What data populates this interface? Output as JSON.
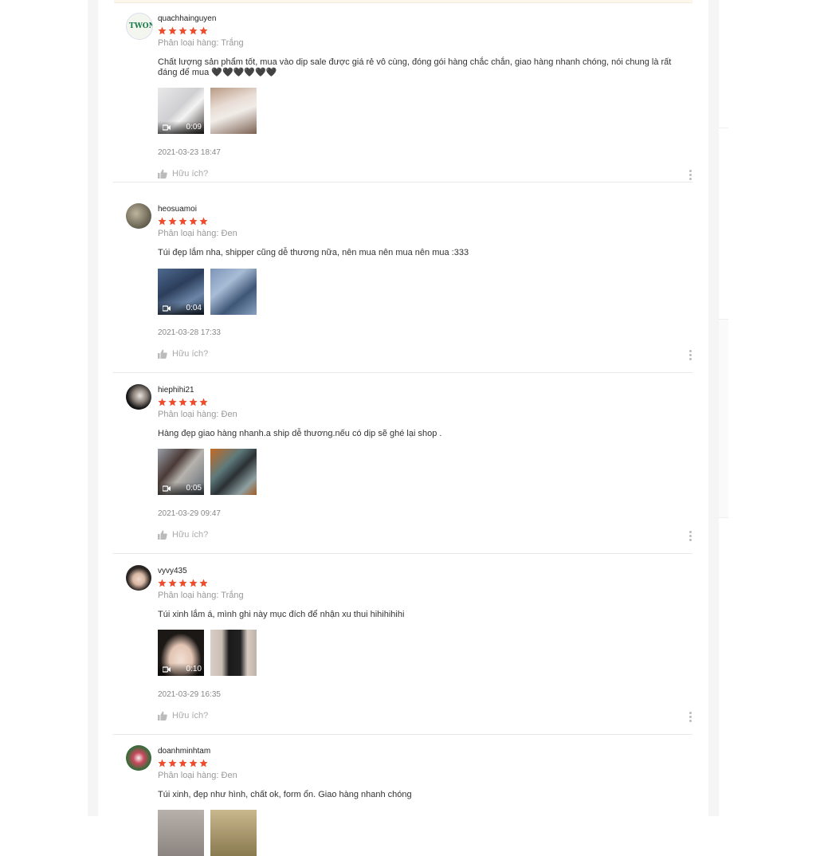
{
  "colors": {
    "star": "#ee4d2d",
    "text": "#333333",
    "muted": "#999999"
  },
  "helpful_label": "Hữu ích?",
  "reviews": [
    {
      "username": "quachhainguyen",
      "avatar_text": "TWON",
      "rating": 5,
      "variant": "Phân loại hàng: Trắng",
      "comment": "Chất lượng sản phẩm tốt, mua vào dịp sale được giá rẻ vô cùng, đóng gói hàng chắc chắn, giao hàng nhanh chóng, nói chung là rất đáng để mua 🖤🖤🖤🖤🖤🖤",
      "video_duration": "0:09",
      "date": "2021-03-23 18:47"
    },
    {
      "username": "heosuamoi",
      "rating": 5,
      "variant": "Phân loại hàng: Đen",
      "comment": "Túi đẹp lắm nha, shipper cũng dễ thương nữa, nên mua nên mua nên mua :333",
      "video_duration": "0:04",
      "date": "2021-03-28 17:33"
    },
    {
      "username": "hiephihi21",
      "rating": 5,
      "variant": "Phân loại hàng: Đen",
      "comment": "Hàng đẹp giao hàng nhanh.a ship dễ thương.nếu có dịp sẽ ghé lại shop .",
      "video_duration": "0:05",
      "date": "2021-03-29 09:47"
    },
    {
      "username": "vyvy435",
      "rating": 5,
      "variant": "Phân loại hàng: Trắng",
      "comment": "Túi xinh lắm á, mình ghi này mục đích để nhận xu thui hihihihihi",
      "video_duration": "0:10",
      "date": "2021-03-29 16:35"
    },
    {
      "username": "doanhminhtam",
      "rating": 5,
      "variant": "Phân loại hàng: Đen",
      "comment": "Túi xinh, đẹp như hình, chất ok, form ổn. Giao hàng nhanh chóng"
    }
  ]
}
